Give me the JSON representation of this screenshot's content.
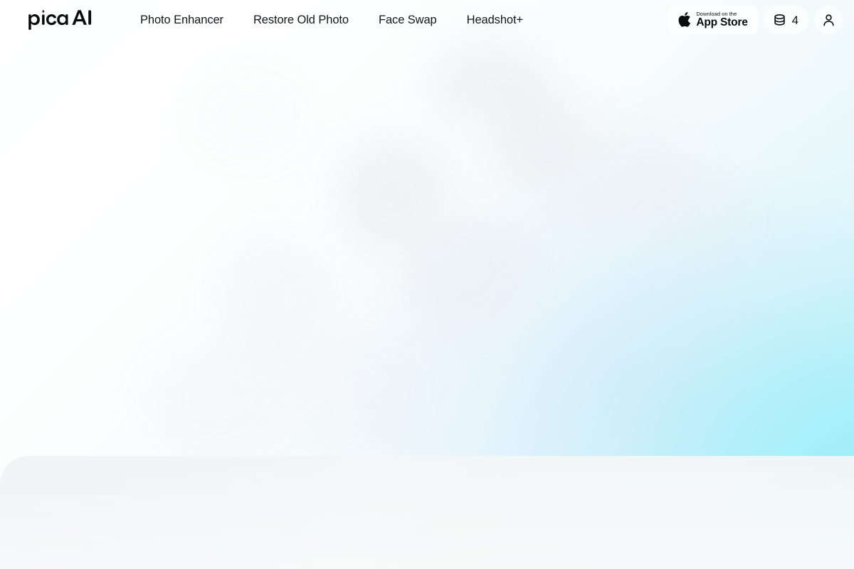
{
  "brand": {
    "name": "Pica AI",
    "logo_icon": "pica-ai-wordmark-with-sparkle"
  },
  "nav": {
    "items": [
      {
        "label": "Photo Enhancer"
      },
      {
        "label": "Restore Old Photo"
      },
      {
        "label": "Face Swap"
      },
      {
        "label": "Headshot+"
      }
    ]
  },
  "header_actions": {
    "app_store": {
      "icon": "apple-logo-icon",
      "superline": "Download on the",
      "mainline": "App Store"
    },
    "credits": {
      "icon": "coin-stack-icon",
      "count": "4"
    },
    "account": {
      "icon": "user-avatar-icon"
    }
  },
  "theme": {
    "text_primary": "#14161a",
    "surface_white": "#ffffff",
    "accent_aqua": "#a7f1fa",
    "accent_aqua_deep": "#96eef9",
    "accent_blue_haze": "#cadaf8",
    "panel_gray": "#f1f3f5",
    "blob_gray": "#e9ecf1"
  }
}
